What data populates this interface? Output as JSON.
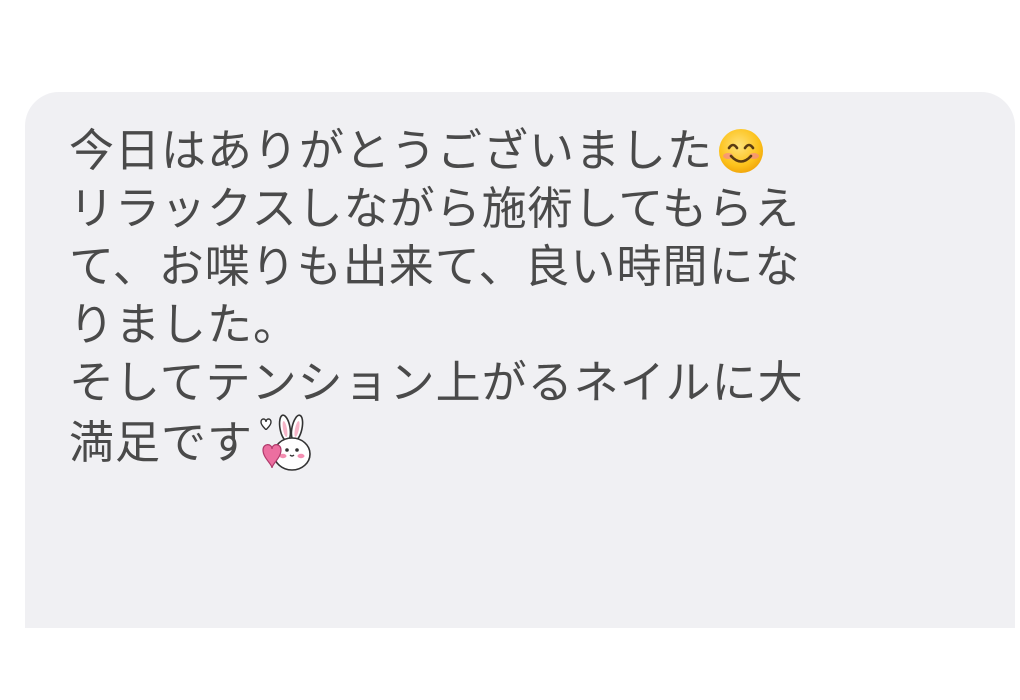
{
  "message": {
    "lines": [
      "今日はありがとうございました",
      "リラックスしながら施術してもらえ",
      "て、お喋りも出来て、良い時間にな",
      "りました。",
      "そしてテンション上がるネイルに大",
      "満足です"
    ],
    "line_1_emoji": "smiling-face-icon",
    "line_6_sticker": "bunny-heart-sticker-icon"
  },
  "colors": {
    "bubble_background": "#f0f0f3",
    "text": "#4a4a4a",
    "page_background": "#ffffff"
  }
}
